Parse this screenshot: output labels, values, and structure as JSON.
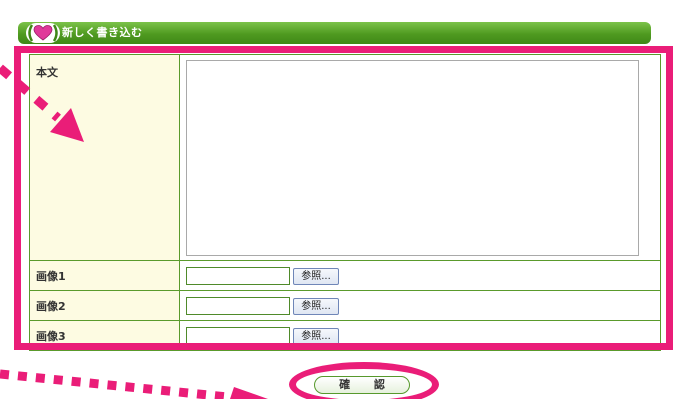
{
  "header": {
    "title": "新しく書き込む"
  },
  "form": {
    "body_label": "本文",
    "body_value": "",
    "images": [
      {
        "label": "画像1",
        "value": "",
        "browse_label": "参照..."
      },
      {
        "label": "画像2",
        "value": "",
        "browse_label": "参照..."
      },
      {
        "label": "画像3",
        "value": "",
        "browse_label": "参照..."
      }
    ],
    "confirm_label": "確 認"
  },
  "colors": {
    "header_green": "#4f9a20",
    "border_green": "#5a9a2c",
    "label_bg": "#fdfbe2",
    "annotation_pink": "#ea1d78"
  },
  "icons": {
    "header_badge": "heart-icon"
  }
}
